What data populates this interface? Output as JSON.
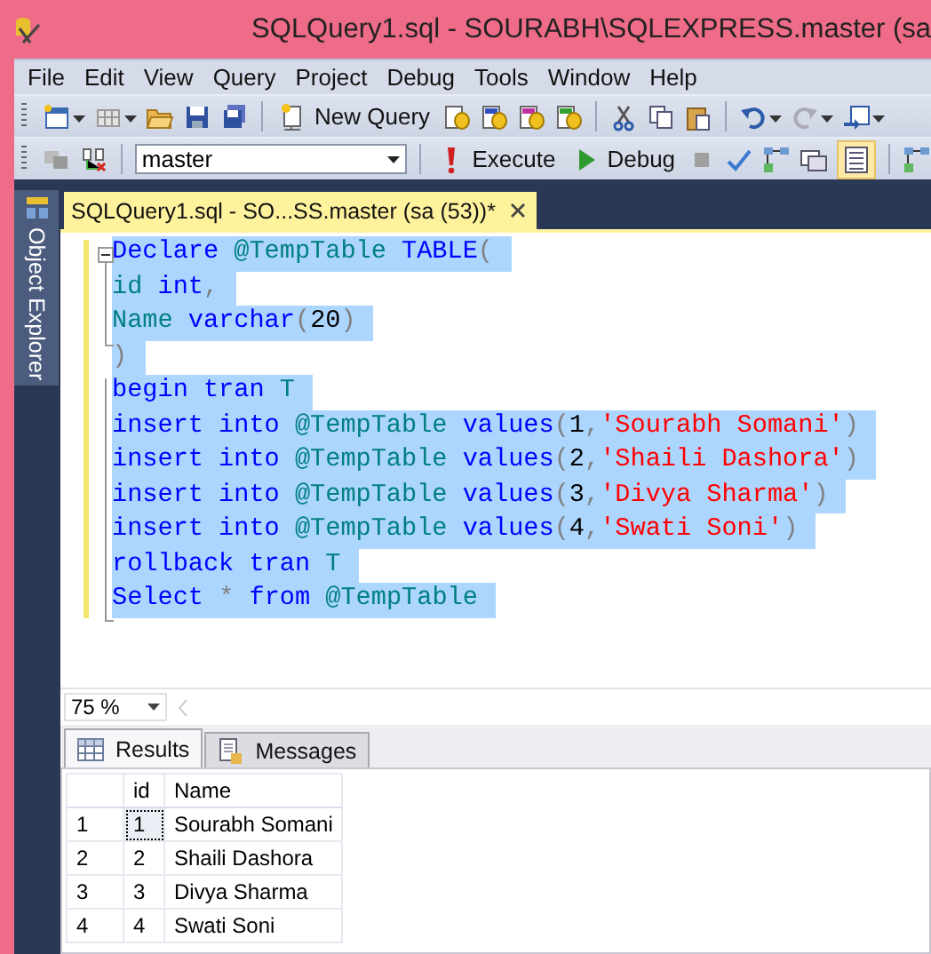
{
  "window": {
    "title": "SQLQuery1.sql - SOURABH\\SQLEXPRESS.master (sa"
  },
  "menu": [
    "File",
    "Edit",
    "View",
    "Query",
    "Project",
    "Debug",
    "Tools",
    "Window",
    "Help"
  ],
  "toolbar": {
    "new_query": "New Query",
    "database": "master",
    "execute": "Execute",
    "debug": "Debug",
    "results_to_grid_on": true
  },
  "side_tab": "Object Explorer",
  "document_tab": {
    "title": "SQLQuery1.sql - SO...SS.master (sa (53))*",
    "modified": true
  },
  "editor": {
    "lines": [
      {
        "selected": true,
        "tokens": [
          {
            "kind": "keyword",
            "text": "Declare"
          },
          {
            "kind": "identifier",
            "text": " @TempTable"
          },
          {
            "kind": "keyword",
            "text": " TABLE"
          },
          {
            "kind": "punct",
            "text": "("
          }
        ]
      },
      {
        "selected": true,
        "tokens": [
          {
            "kind": "identifier",
            "text": "id"
          },
          {
            "kind": "keyword",
            "text": " int"
          },
          {
            "kind": "punct",
            "text": ","
          }
        ]
      },
      {
        "selected": true,
        "tokens": [
          {
            "kind": "identifier",
            "text": "Name"
          },
          {
            "kind": "keyword",
            "text": " varchar"
          },
          {
            "kind": "punct",
            "text": "("
          },
          {
            "kind": "number",
            "text": "20"
          },
          {
            "kind": "punct",
            "text": ")"
          }
        ]
      },
      {
        "selected": true,
        "tokens": [
          {
            "kind": "punct",
            "text": ")"
          }
        ]
      },
      {
        "selected": true,
        "tokens": [
          {
            "kind": "keyword",
            "text": "begin tran"
          },
          {
            "kind": "identifier",
            "text": " T"
          }
        ]
      },
      {
        "selected": true,
        "tokens": [
          {
            "kind": "keyword",
            "text": "insert into"
          },
          {
            "kind": "identifier",
            "text": " @TempTable"
          },
          {
            "kind": "keyword",
            "text": " values"
          },
          {
            "kind": "punct",
            "text": "("
          },
          {
            "kind": "number",
            "text": "1"
          },
          {
            "kind": "punct",
            "text": ","
          },
          {
            "kind": "string",
            "text": "'Sourabh Somani'"
          },
          {
            "kind": "punct",
            "text": ")"
          }
        ]
      },
      {
        "selected": true,
        "tokens": [
          {
            "kind": "keyword",
            "text": "insert into"
          },
          {
            "kind": "identifier",
            "text": " @TempTable"
          },
          {
            "kind": "keyword",
            "text": " values"
          },
          {
            "kind": "punct",
            "text": "("
          },
          {
            "kind": "number",
            "text": "2"
          },
          {
            "kind": "punct",
            "text": ","
          },
          {
            "kind": "string",
            "text": "'Shaili Dashora'"
          },
          {
            "kind": "punct",
            "text": ")"
          }
        ]
      },
      {
        "selected": true,
        "tokens": [
          {
            "kind": "keyword",
            "text": "insert into"
          },
          {
            "kind": "identifier",
            "text": " @TempTable"
          },
          {
            "kind": "keyword",
            "text": " values"
          },
          {
            "kind": "punct",
            "text": "("
          },
          {
            "kind": "number",
            "text": "3"
          },
          {
            "kind": "punct",
            "text": ","
          },
          {
            "kind": "string",
            "text": "'Divya Sharma'"
          },
          {
            "kind": "punct",
            "text": ")"
          }
        ]
      },
      {
        "selected": true,
        "tokens": [
          {
            "kind": "keyword",
            "text": "insert into"
          },
          {
            "kind": "identifier",
            "text": " @TempTable"
          },
          {
            "kind": "keyword",
            "text": " values"
          },
          {
            "kind": "punct",
            "text": "("
          },
          {
            "kind": "number",
            "text": "4"
          },
          {
            "kind": "punct",
            "text": ","
          },
          {
            "kind": "string",
            "text": "'Swati Soni'"
          },
          {
            "kind": "punct",
            "text": ")"
          }
        ]
      },
      {
        "selected": true,
        "tokens": [
          {
            "kind": "keyword",
            "text": "rollback tran"
          },
          {
            "kind": "identifier",
            "text": " T"
          }
        ]
      },
      {
        "selected": true,
        "tokens": [
          {
            "kind": "keyword",
            "text": "Select"
          },
          {
            "kind": "punct",
            "text": " *"
          },
          {
            "kind": "keyword",
            "text": " from"
          },
          {
            "kind": "identifier",
            "text": " @TempTable"
          }
        ]
      }
    ]
  },
  "zoom": "75 %",
  "result_tabs": [
    {
      "label": "Results",
      "selected": true
    },
    {
      "label": "Messages",
      "selected": false
    }
  ],
  "grid": {
    "columns": [
      "id",
      "Name"
    ],
    "rows": [
      {
        "number": "1",
        "cells": [
          "1",
          "Sourabh Somani"
        ],
        "focused": true
      },
      {
        "number": "2",
        "cells": [
          "2",
          "Shaili Dashora"
        ],
        "focused": false
      },
      {
        "number": "3",
        "cells": [
          "3",
          "Divya Sharma"
        ],
        "focused": false
      },
      {
        "number": "4",
        "cells": [
          "4",
          "Swati Soni"
        ],
        "focused": false
      }
    ]
  }
}
